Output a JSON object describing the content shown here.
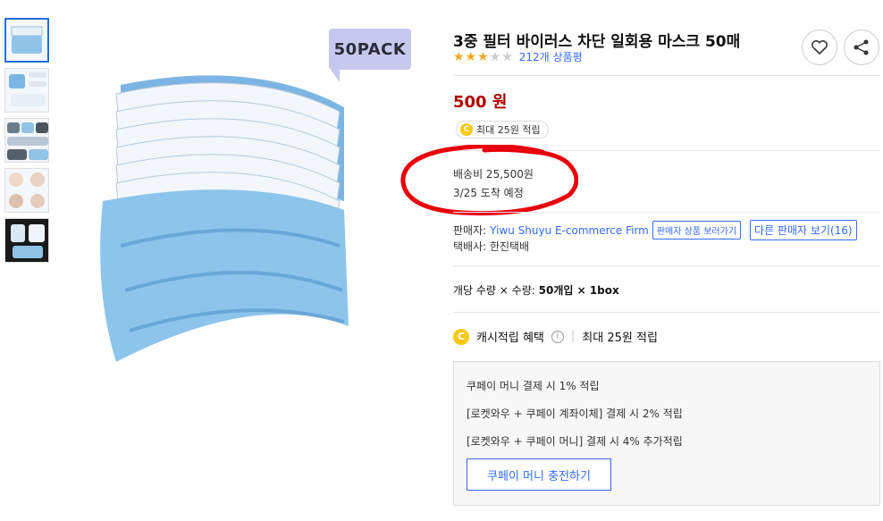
{
  "thumbnails": [
    {
      "label": "thumb-1"
    },
    {
      "label": "thumb-2"
    },
    {
      "label": "thumb-3"
    },
    {
      "label": "thumb-4"
    },
    {
      "label": "thumb-5"
    }
  ],
  "badge": "50PACK",
  "product": {
    "title": "3중 필터 바이러스 차단 일회용 마스크 50매",
    "rating_stars": 3,
    "review_count": "212개 상품평"
  },
  "price": {
    "amount": "500",
    "unit": "원",
    "reward_pill": "최대 25원 적립",
    "coin_glyph": "C"
  },
  "shipping": {
    "fee": "배송비 25,500원",
    "arrival": "3/25 도착 예정"
  },
  "seller": {
    "label": "판매자:",
    "name": "Yiwu Shuyu E-commerce Firm",
    "view_products_btn": "판매자 상품 보러가기",
    "other_sellers_btn": "다른 판매자 보기(16)",
    "courier": "택배사: 한진택배"
  },
  "option": {
    "prefix": "개당 수량 × 수량:",
    "value": "50개입 × 1box"
  },
  "cash_reward": {
    "label": "캐시적립 혜택",
    "info": "i",
    "separator": "|",
    "value": "최대 25원 적립"
  },
  "benefits": {
    "line1": "쿠페이 머니 결제 시 1% 적립",
    "line2": "[로켓와우 + 쿠페이 계좌이체] 결제 시 2% 적립",
    "line3": "[로켓와우 + 쿠페이 머니] 결제 시 4% 추가적립",
    "charge_button": "쿠페이 머니 충전하기"
  },
  "colors": {
    "accent_blue": "#346aff",
    "price_red": "#ae0000",
    "star": "#f6a51a",
    "coin": "#f8c814",
    "annotation_red": "#e8000b"
  }
}
